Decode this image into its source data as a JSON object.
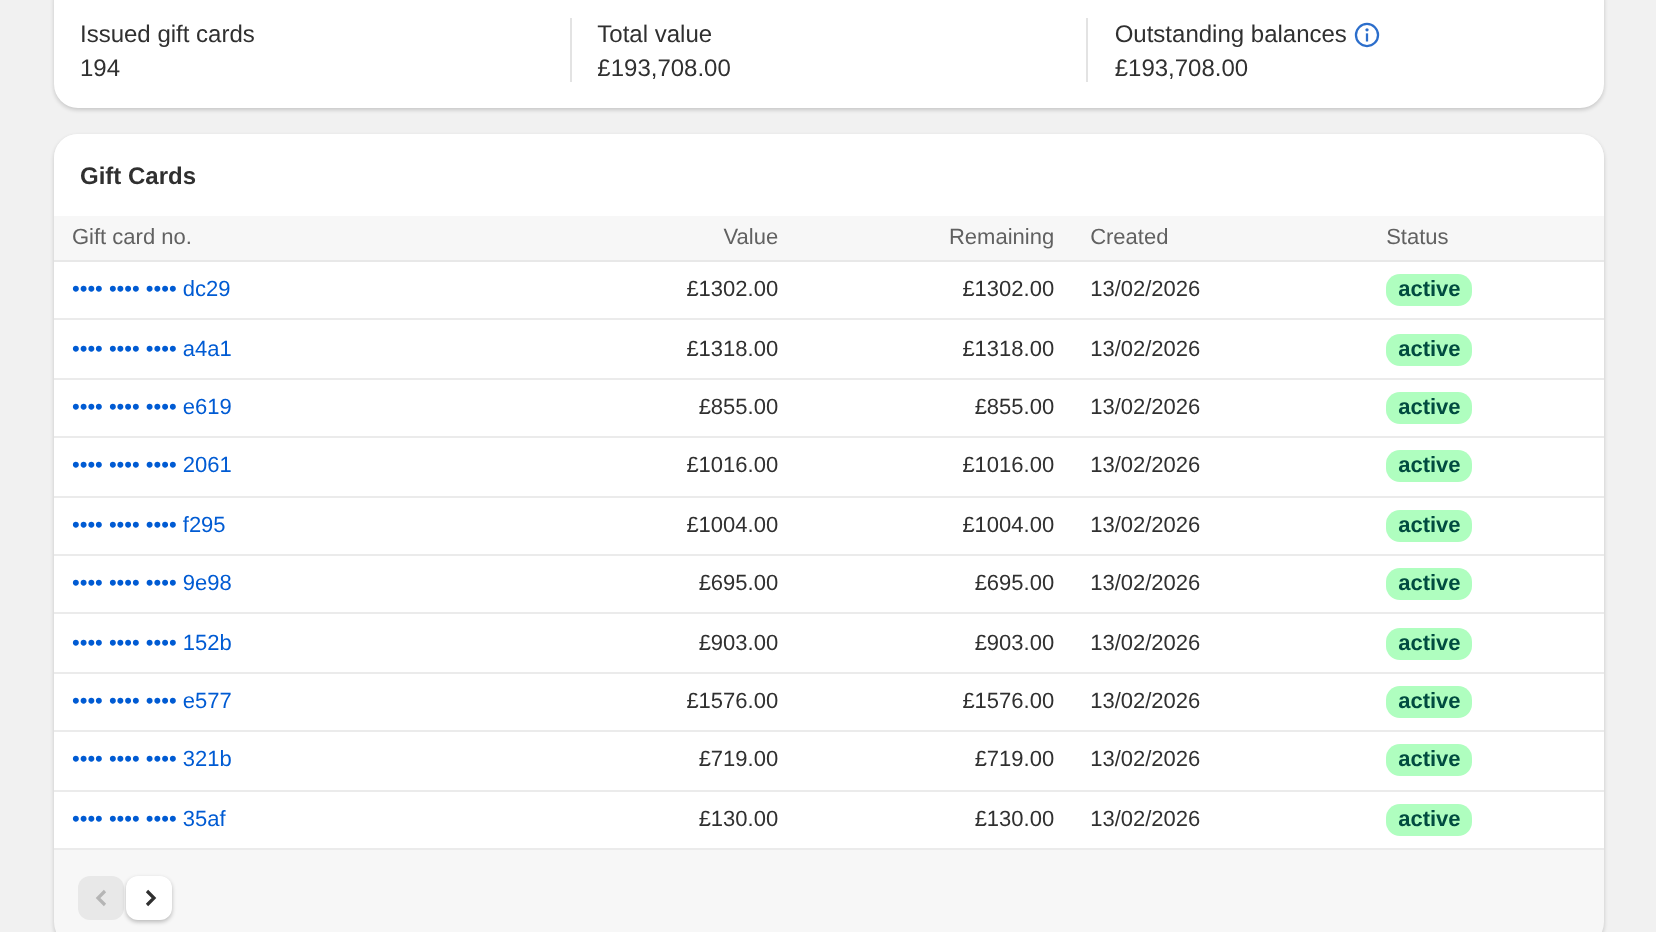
{
  "summary": [
    {
      "label": "Issued gift cards",
      "value": "194",
      "info": false
    },
    {
      "label": "Total value",
      "value": "£193,708.00",
      "info": false
    },
    {
      "label": "Outstanding balances",
      "value": "£193,708.00",
      "info": true
    }
  ],
  "gift_cards": {
    "title": "Gift Cards",
    "columns": [
      "Gift card no.",
      "Value",
      "Remaining",
      "Created",
      "Status"
    ],
    "rows": [
      {
        "number": "•••• •••• •••• dc29",
        "value": "£1302.00",
        "remaining": "£1302.00",
        "created": "13/02/2026",
        "status": "active"
      },
      {
        "number": "•••• •••• •••• a4a1",
        "value": "£1318.00",
        "remaining": "£1318.00",
        "created": "13/02/2026",
        "status": "active"
      },
      {
        "number": "•••• •••• •••• e619",
        "value": "£855.00",
        "remaining": "£855.00",
        "created": "13/02/2026",
        "status": "active"
      },
      {
        "number": "•••• •••• •••• 2061",
        "value": "£1016.00",
        "remaining": "£1016.00",
        "created": "13/02/2026",
        "status": "active"
      },
      {
        "number": "•••• •••• •••• f295",
        "value": "£1004.00",
        "remaining": "£1004.00",
        "created": "13/02/2026",
        "status": "active"
      },
      {
        "number": "•••• •••• •••• 9e98",
        "value": "£695.00",
        "remaining": "£695.00",
        "created": "13/02/2026",
        "status": "active"
      },
      {
        "number": "•••• •••• •••• 152b",
        "value": "£903.00",
        "remaining": "£903.00",
        "created": "13/02/2026",
        "status": "active"
      },
      {
        "number": "•••• •••• •••• e577",
        "value": "£1576.00",
        "remaining": "£1576.00",
        "created": "13/02/2026",
        "status": "active"
      },
      {
        "number": "•••• •••• •••• 321b",
        "value": "£719.00",
        "remaining": "£719.00",
        "created": "13/02/2026",
        "status": "active"
      },
      {
        "number": "•••• •••• •••• 35af",
        "value": "£130.00",
        "remaining": "£130.00",
        "created": "13/02/2026",
        "status": "active"
      }
    ],
    "pagination": {
      "previous_disabled": true,
      "next_disabled": false
    }
  }
}
